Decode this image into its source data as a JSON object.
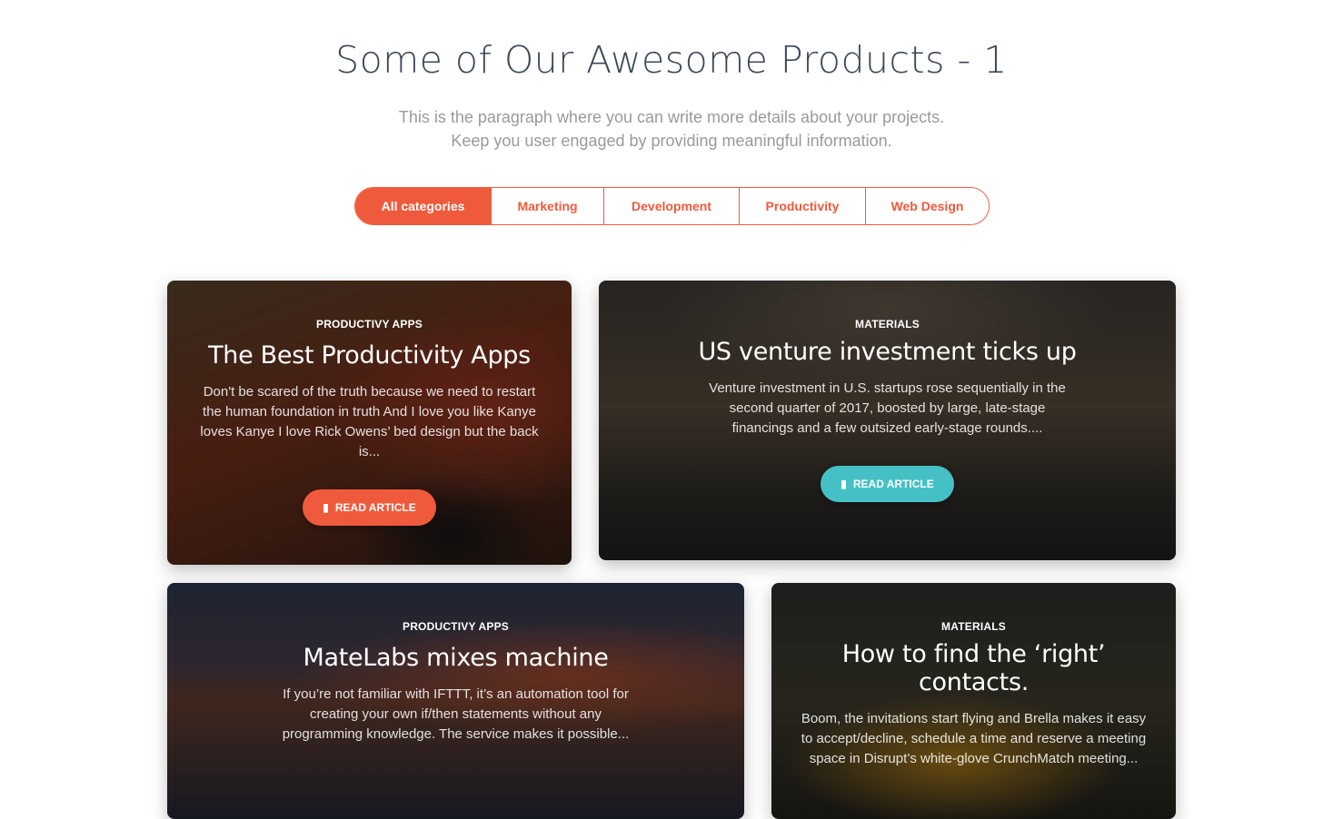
{
  "header": {
    "title": "Some of Our Awesome Products - 1",
    "subtitle_line1": "This is the paragraph where you can write more details about your projects.",
    "subtitle_line2": "Keep you user engaged by providing meaningful information."
  },
  "tabs": [
    {
      "label": "All categories",
      "active": true
    },
    {
      "label": "Marketing",
      "active": false
    },
    {
      "label": "Development",
      "active": false
    },
    {
      "label": "Productivity",
      "active": false
    },
    {
      "label": "Web Design",
      "active": false
    }
  ],
  "cards": [
    {
      "category": "PRODUCTIVY APPS",
      "title": "The Best Productivity Apps",
      "description": "Don't be scared of the truth because we need to restart the human foundation in truth And I love you like Kanye loves Kanye I love Rick Owens’ bed design but the back is...",
      "button": "READ ARTICLE",
      "button_color": "#f05a3c"
    },
    {
      "category": "MATERIALS",
      "title": "US venture investment ticks up",
      "description": "Venture investment in U.S. startups rose sequentially in the second quarter of 2017, boosted by large, late-stage financings and a few outsized early-stage rounds....",
      "button": "READ ARTICLE",
      "button_color": "#45c0c6"
    },
    {
      "category": "PRODUCTIVY APPS",
      "title": "MateLabs mixes machine",
      "description": "If you’re not familiar with IFTTT, it’s an automation tool for creating your own if/then statements without any programming knowledge. The service makes it possible..."
    },
    {
      "category": "MATERIALS",
      "title": "How to find the ‘right’ contacts.",
      "description": "Boom, the invitations start flying and Brella makes it easy to accept/decline, schedule a time and reserve a meeting space in Disrupt’s white-glove CrunchMatch meeting..."
    }
  ],
  "icons": {
    "button_icon": "book-icon"
  }
}
